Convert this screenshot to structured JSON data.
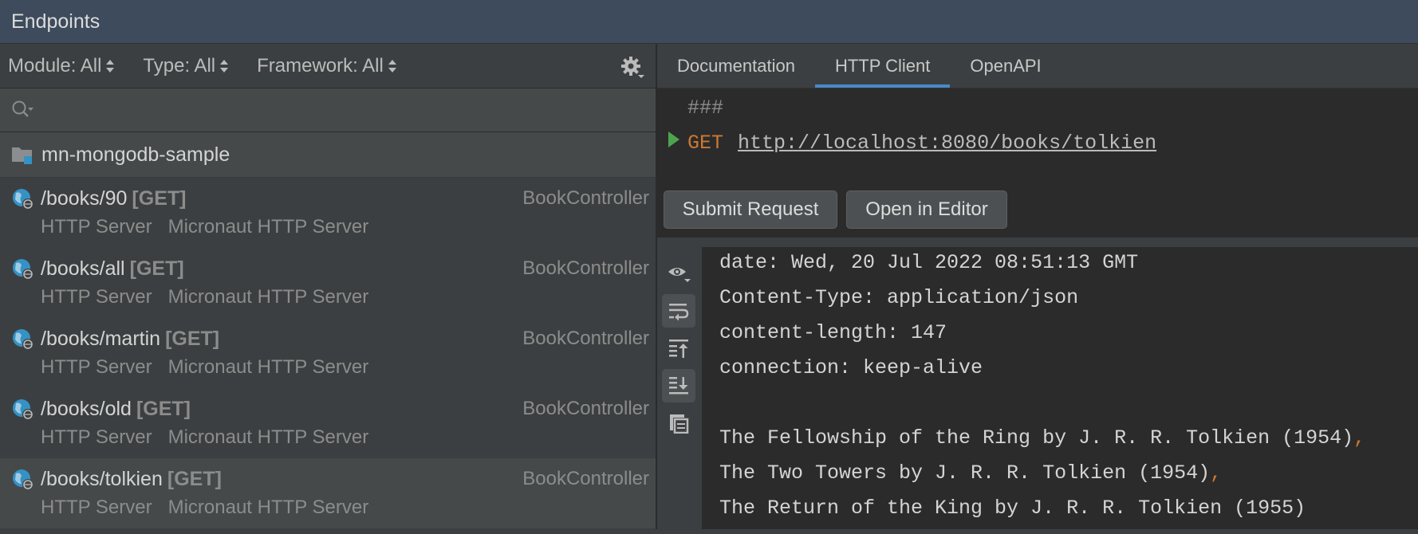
{
  "window": {
    "title": "Endpoints"
  },
  "filters": [
    {
      "label": "Module: All"
    },
    {
      "label": "Type: All"
    },
    {
      "label": "Framework: All"
    }
  ],
  "search": {
    "value": "",
    "placeholder": ""
  },
  "project": {
    "name": "mn-mongodb-sample"
  },
  "endpoints": [
    {
      "path": "/books/90",
      "method": "[GET]",
      "controller": "BookController",
      "type": "HTTP Server",
      "framework": "Micronaut HTTP Server"
    },
    {
      "path": "/books/all",
      "method": "[GET]",
      "controller": "BookController",
      "type": "HTTP Server",
      "framework": "Micronaut HTTP Server"
    },
    {
      "path": "/books/martin",
      "method": "[GET]",
      "controller": "BookController",
      "type": "HTTP Server",
      "framework": "Micronaut HTTP Server"
    },
    {
      "path": "/books/old",
      "method": "[GET]",
      "controller": "BookController",
      "type": "HTTP Server",
      "framework": "Micronaut HTTP Server"
    },
    {
      "path": "/books/tolkien",
      "method": "[GET]",
      "controller": "BookController",
      "type": "HTTP Server",
      "framework": "Micronaut HTTP Server"
    }
  ],
  "tabs": [
    {
      "label": "Documentation"
    },
    {
      "label": "HTTP Client"
    },
    {
      "label": "OpenAPI"
    }
  ],
  "request": {
    "separator": "###",
    "method": "GET",
    "url": "http://localhost:8080/books/tolkien"
  },
  "buttons": {
    "submit": "Submit Request",
    "open_editor": "Open in Editor"
  },
  "response": {
    "headers": [
      "date: Wed, 20 Jul 2022 08:51:13 GMT",
      "Content-Type: application/json",
      "content-length: 147",
      "connection: keep-alive"
    ],
    "body": [
      "The Fellowship of the Ring by J. R. R. Tolkien (1954)",
      "The Two Towers by J. R. R. Tolkien (1954)",
      "The Return of the King by J. R. R. Tolkien (1955)"
    ],
    "comma": ","
  },
  "colors": {
    "accent": "#4a88c7",
    "method": "#cc7832",
    "run": "#4ea44e"
  }
}
